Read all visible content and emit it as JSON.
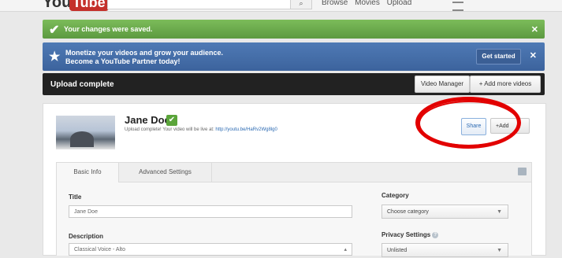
{
  "header": {
    "logo_you": "You",
    "logo_tube": "Tube",
    "nav": [
      "Browse",
      "Movies",
      "Upload"
    ]
  },
  "notifications": {
    "saved_message": "Your changes were saved.",
    "promo_line1": "Monetize your videos and grow your audience.",
    "promo_line2": "Become a YouTube Partner today!",
    "get_started_label": "Get started"
  },
  "upload_bar": {
    "title": "Upload complete",
    "video_manager_label": "Video Manager",
    "add_more_label": "+ Add more videos"
  },
  "video": {
    "title": "Jane Doe",
    "upload_prefix": "Upload complete! Your video will be live at:",
    "url": "http://youtu.be/HaRv2Wg8lg0",
    "share_label": "Share",
    "add_to_label": "+Add"
  },
  "tabs": {
    "basic": "Basic Info",
    "advanced": "Advanced Settings"
  },
  "form": {
    "title_label": "Title",
    "title_value": "Jane Doe",
    "description_label": "Description",
    "description_value": "Classical Voice - Alto",
    "category_label": "Category",
    "category_value": "Choose category",
    "privacy_label": "Privacy Settings",
    "privacy_value": "Unlisted"
  },
  "colors": {
    "success": "#6aa84f",
    "promo": "#4a73ad",
    "annotation": "#e20000"
  }
}
